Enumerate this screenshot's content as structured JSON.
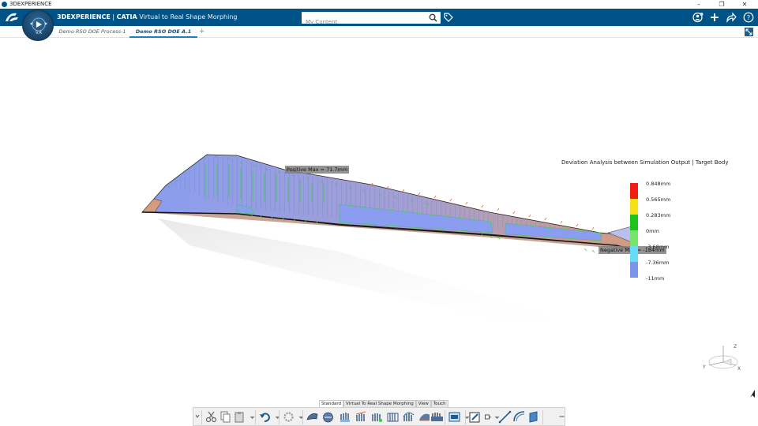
{
  "window": {
    "title": "3DEXPERIENCE",
    "controls": [
      "–",
      "❐",
      "✕"
    ]
  },
  "header": {
    "brand_bold": "3DEXPERIENCE",
    "brand_sep": " | ",
    "brand_product": "CATIA",
    "app_name": "Virtual to Real Shape Morphing",
    "search_placeholder": "My Content",
    "compass_version": "V.R"
  },
  "tabs": [
    {
      "label": "Demo RSO DOE Process-1",
      "active": false
    },
    {
      "label": "Demo RSO DOE A.1",
      "active": true
    }
  ],
  "tab_add": "+",
  "markers": {
    "positive": "Positive Max = 71.7mm",
    "negative": "Negative Max = -184mm"
  },
  "legend": {
    "title": "Deviation Analysis between Simulation Output | Target Body",
    "labels": [
      "0.848mm",
      "0.565mm",
      "0.283mm",
      "0mm",
      "-3.68mm",
      "-7.36mm",
      "-11mm"
    ],
    "colors": [
      "#f01c12",
      "#f7e116",
      "#1fc21b",
      "#76e56b",
      "#66dcf6",
      "#7e94ea"
    ]
  },
  "axis": {
    "x": "X",
    "y": "Y",
    "z": "Z"
  },
  "workbench_tabs": [
    {
      "label": "Standard",
      "active": true
    },
    {
      "label": "Virtual To Real Shape Morphing",
      "active": false
    },
    {
      "label": "View",
      "active": false
    },
    {
      "label": "Touch",
      "active": false
    }
  ],
  "colors": {
    "header_blue": "#005386",
    "wing_blue": "#8a9df0",
    "wing_orange": "#d69a7e",
    "green_points": "#2fd13b"
  }
}
